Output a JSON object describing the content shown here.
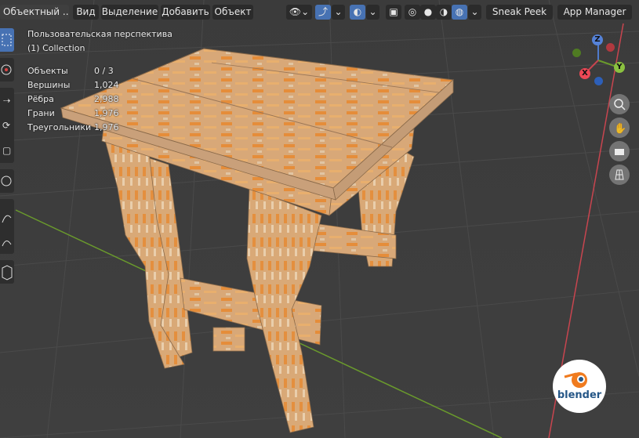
{
  "header": {
    "mode_label": "Объектный ...",
    "menu": [
      "Вид",
      "Выделение",
      "Добавить",
      "Объект"
    ],
    "sneak_peek": "Sneak Peek",
    "app_manager": "App Manager"
  },
  "overlay": {
    "view_name": "Пользовательская перспектива",
    "collection": "(1) Collection",
    "stats": [
      {
        "label": "Объекты",
        "value": "0 / 3"
      },
      {
        "label": "Вершины",
        "value": "1,024"
      },
      {
        "label": "Рёбра",
        "value": "2,988"
      },
      {
        "label": "Грани",
        "value": "1,976"
      },
      {
        "label": "Треугольники",
        "value": "1,976"
      }
    ]
  },
  "gizmo": {
    "x": "X",
    "y": "Y",
    "z": "Z"
  },
  "logo": {
    "text": "blender"
  },
  "colors": {
    "accent": "#4772b3",
    "grid_red": "#c8454f",
    "grid_green": "#6a9a2c",
    "wood_orange": "#e8862a"
  }
}
